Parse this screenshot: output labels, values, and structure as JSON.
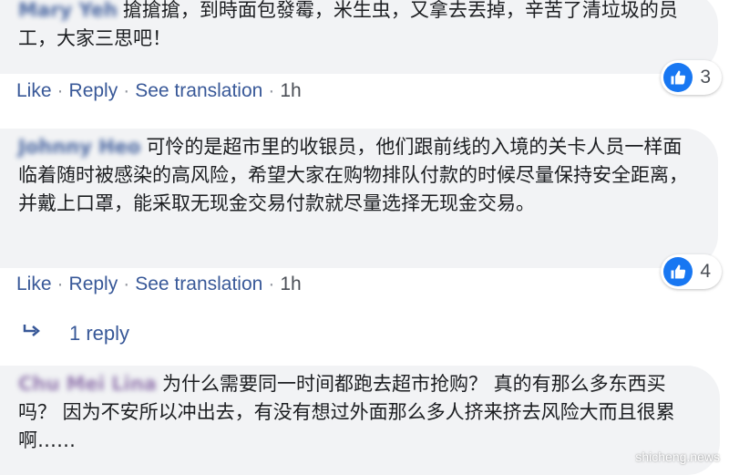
{
  "comments": [
    {
      "author": "Mary Yeh",
      "text": "搶搶搶，到時面包發霉，米生虫，又拿去丟掉，辛苦了清垃圾的员工，大家三思吧！",
      "reaction_count": "3"
    },
    {
      "author": "Johnny Heo",
      "text": "可怜的是超市里的收银员，他们跟前线的入境的关卡人员一样面临着随时被感染的高风险，希望大家在购物排队付款的时候尽量保持安全距离，并戴上口罩，能采取无现金交易付款就尽量选择无现金交易。",
      "reaction_count": "4"
    },
    {
      "author": "Chu Mei Lina",
      "text": "为什么需要同一时间都跑去超市抢购？ 真的有那么多东西买吗？ 因为不安所以冲出去，有没有想过外面那么多人挤来挤去风险大而且很累啊……"
    }
  ],
  "actions": {
    "like": "Like",
    "reply": "Reply",
    "see_translation": "See translation",
    "separator": "·",
    "time": "1h"
  },
  "replies_link": "1 reply",
  "watermark": "shicheng.news",
  "colors": {
    "link": "#385898",
    "bubble": "#f2f3f5",
    "like_blue": "#1877f2"
  }
}
